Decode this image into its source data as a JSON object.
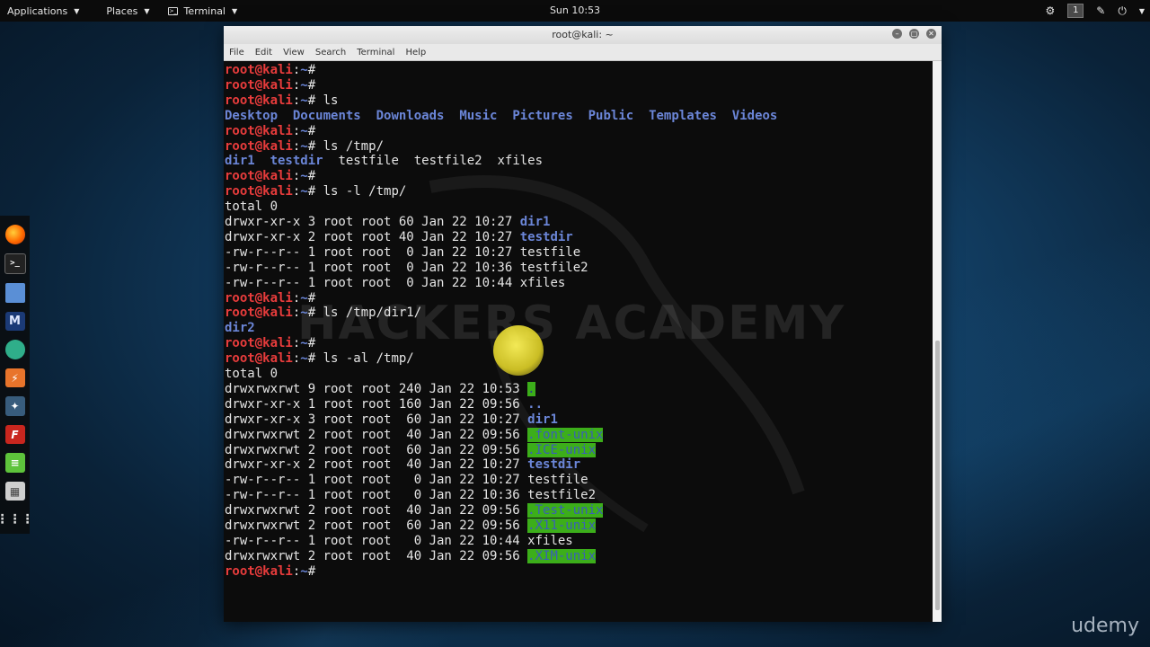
{
  "topbar": {
    "applications": "Applications",
    "places": "Places",
    "terminal": "Terminal",
    "clock": "Sun 10:53",
    "workspace": "1"
  },
  "window": {
    "title": "root@kali: ~",
    "menu": [
      "File",
      "Edit",
      "View",
      "Search",
      "Terminal",
      "Help"
    ]
  },
  "prompt": {
    "user": "root@kali",
    "path": "~",
    "symbol": "# "
  },
  "lines": [
    {
      "type": "prompt",
      "cmd": ""
    },
    {
      "type": "prompt",
      "cmd": ""
    },
    {
      "type": "prompt",
      "cmd": "ls"
    },
    {
      "type": "dirs",
      "items": [
        "Desktop",
        "Documents",
        "Downloads",
        "Music",
        "Pictures",
        "Public",
        "Templates",
        "Videos"
      ]
    },
    {
      "type": "prompt",
      "cmd": ""
    },
    {
      "type": "prompt",
      "cmd": "ls /tmp/"
    },
    {
      "type": "mixed",
      "items": [
        {
          "t": "dir1",
          "d": true
        },
        {
          "t": "testdir",
          "d": true
        },
        {
          "t": "testfile",
          "d": false
        },
        {
          "t": "testfile2",
          "d": false
        },
        {
          "t": "xfiles",
          "d": false
        }
      ]
    },
    {
      "type": "prompt",
      "cmd": ""
    },
    {
      "type": "prompt",
      "cmd": "ls -l /tmp/"
    },
    {
      "type": "text",
      "text": "total 0"
    },
    {
      "type": "entry",
      "meta": "drwxr-xr-x 3 root root 60 Jan 22 10:27 ",
      "name": "dir1",
      "style": "dir"
    },
    {
      "type": "entry",
      "meta": "drwxr-xr-x 2 root root 40 Jan 22 10:27 ",
      "name": "testdir",
      "style": "dir"
    },
    {
      "type": "entry",
      "meta": "-rw-r--r-- 1 root root  0 Jan 22 10:27 ",
      "name": "testfile",
      "style": "plain"
    },
    {
      "type": "entry",
      "meta": "-rw-r--r-- 1 root root  0 Jan 22 10:36 ",
      "name": "testfile2",
      "style": "plain"
    },
    {
      "type": "entry",
      "meta": "-rw-r--r-- 1 root root  0 Jan 22 10:44 ",
      "name": "xfiles",
      "style": "plain"
    },
    {
      "type": "prompt",
      "cmd": ""
    },
    {
      "type": "prompt",
      "cmd": "ls /tmp/dir1/"
    },
    {
      "type": "entry",
      "meta": "",
      "name": "dir2",
      "style": "dir"
    },
    {
      "type": "prompt",
      "cmd": ""
    },
    {
      "type": "prompt",
      "cmd": "ls -al /tmp/"
    },
    {
      "type": "text",
      "text": "total 0"
    },
    {
      "type": "entry",
      "meta": "drwxrwxrwt 9 root root 240 Jan 22 10:53 ",
      "name": ".",
      "style": "hl"
    },
    {
      "type": "entry",
      "meta": "drwxr-xr-x 1 root root 160 Jan 22 09:56 ",
      "name": "..",
      "style": "dir"
    },
    {
      "type": "entry",
      "meta": "drwxr-xr-x 3 root root  60 Jan 22 10:27 ",
      "name": "dir1",
      "style": "dir"
    },
    {
      "type": "entry",
      "meta": "drwxrwxrwt 2 root root  40 Jan 22 09:56 ",
      "name": ".font-unix",
      "style": "hl"
    },
    {
      "type": "entry",
      "meta": "drwxrwxrwt 2 root root  60 Jan 22 09:56 ",
      "name": ".ICE-unix",
      "style": "hl"
    },
    {
      "type": "entry",
      "meta": "drwxr-xr-x 2 root root  40 Jan 22 10:27 ",
      "name": "testdir",
      "style": "dir"
    },
    {
      "type": "entry",
      "meta": "-rw-r--r-- 1 root root   0 Jan 22 10:27 ",
      "name": "testfile",
      "style": "plain"
    },
    {
      "type": "entry",
      "meta": "-rw-r--r-- 1 root root   0 Jan 22 10:36 ",
      "name": "testfile2",
      "style": "plain"
    },
    {
      "type": "entry",
      "meta": "drwxrwxrwt 2 root root  40 Jan 22 09:56 ",
      "name": ".Test-unix",
      "style": "hl"
    },
    {
      "type": "entry",
      "meta": "drwxrwxrwt 2 root root  60 Jan 22 09:56 ",
      "name": ".X11-unix",
      "style": "hl"
    },
    {
      "type": "entry",
      "meta": "-rw-r--r-- 1 root root   0 Jan 22 10:44 ",
      "name": "xfiles",
      "style": "plain"
    },
    {
      "type": "entry",
      "meta": "drwxrwxrwt 2 root root  40 Jan 22 09:56 ",
      "name": ".XIM-unix",
      "style": "hl"
    },
    {
      "type": "prompt",
      "cmd": ""
    }
  ],
  "watermark": "HACKERS ACADEMY",
  "brand": "udemy",
  "colors": {
    "prompt_user": "#e83c3c",
    "prompt_path": "#6b86d8",
    "dir": "#6b86d8",
    "highlight_bg": "#3cae1a"
  },
  "dock": [
    "firefox-icon",
    "terminal-icon",
    "files-icon",
    "metasploit-icon",
    "armitage-icon",
    "burpsuite-icon",
    "beef-icon",
    "faraday-icon",
    "notes-icon",
    "misc-app-icon",
    "show-apps-icon"
  ]
}
